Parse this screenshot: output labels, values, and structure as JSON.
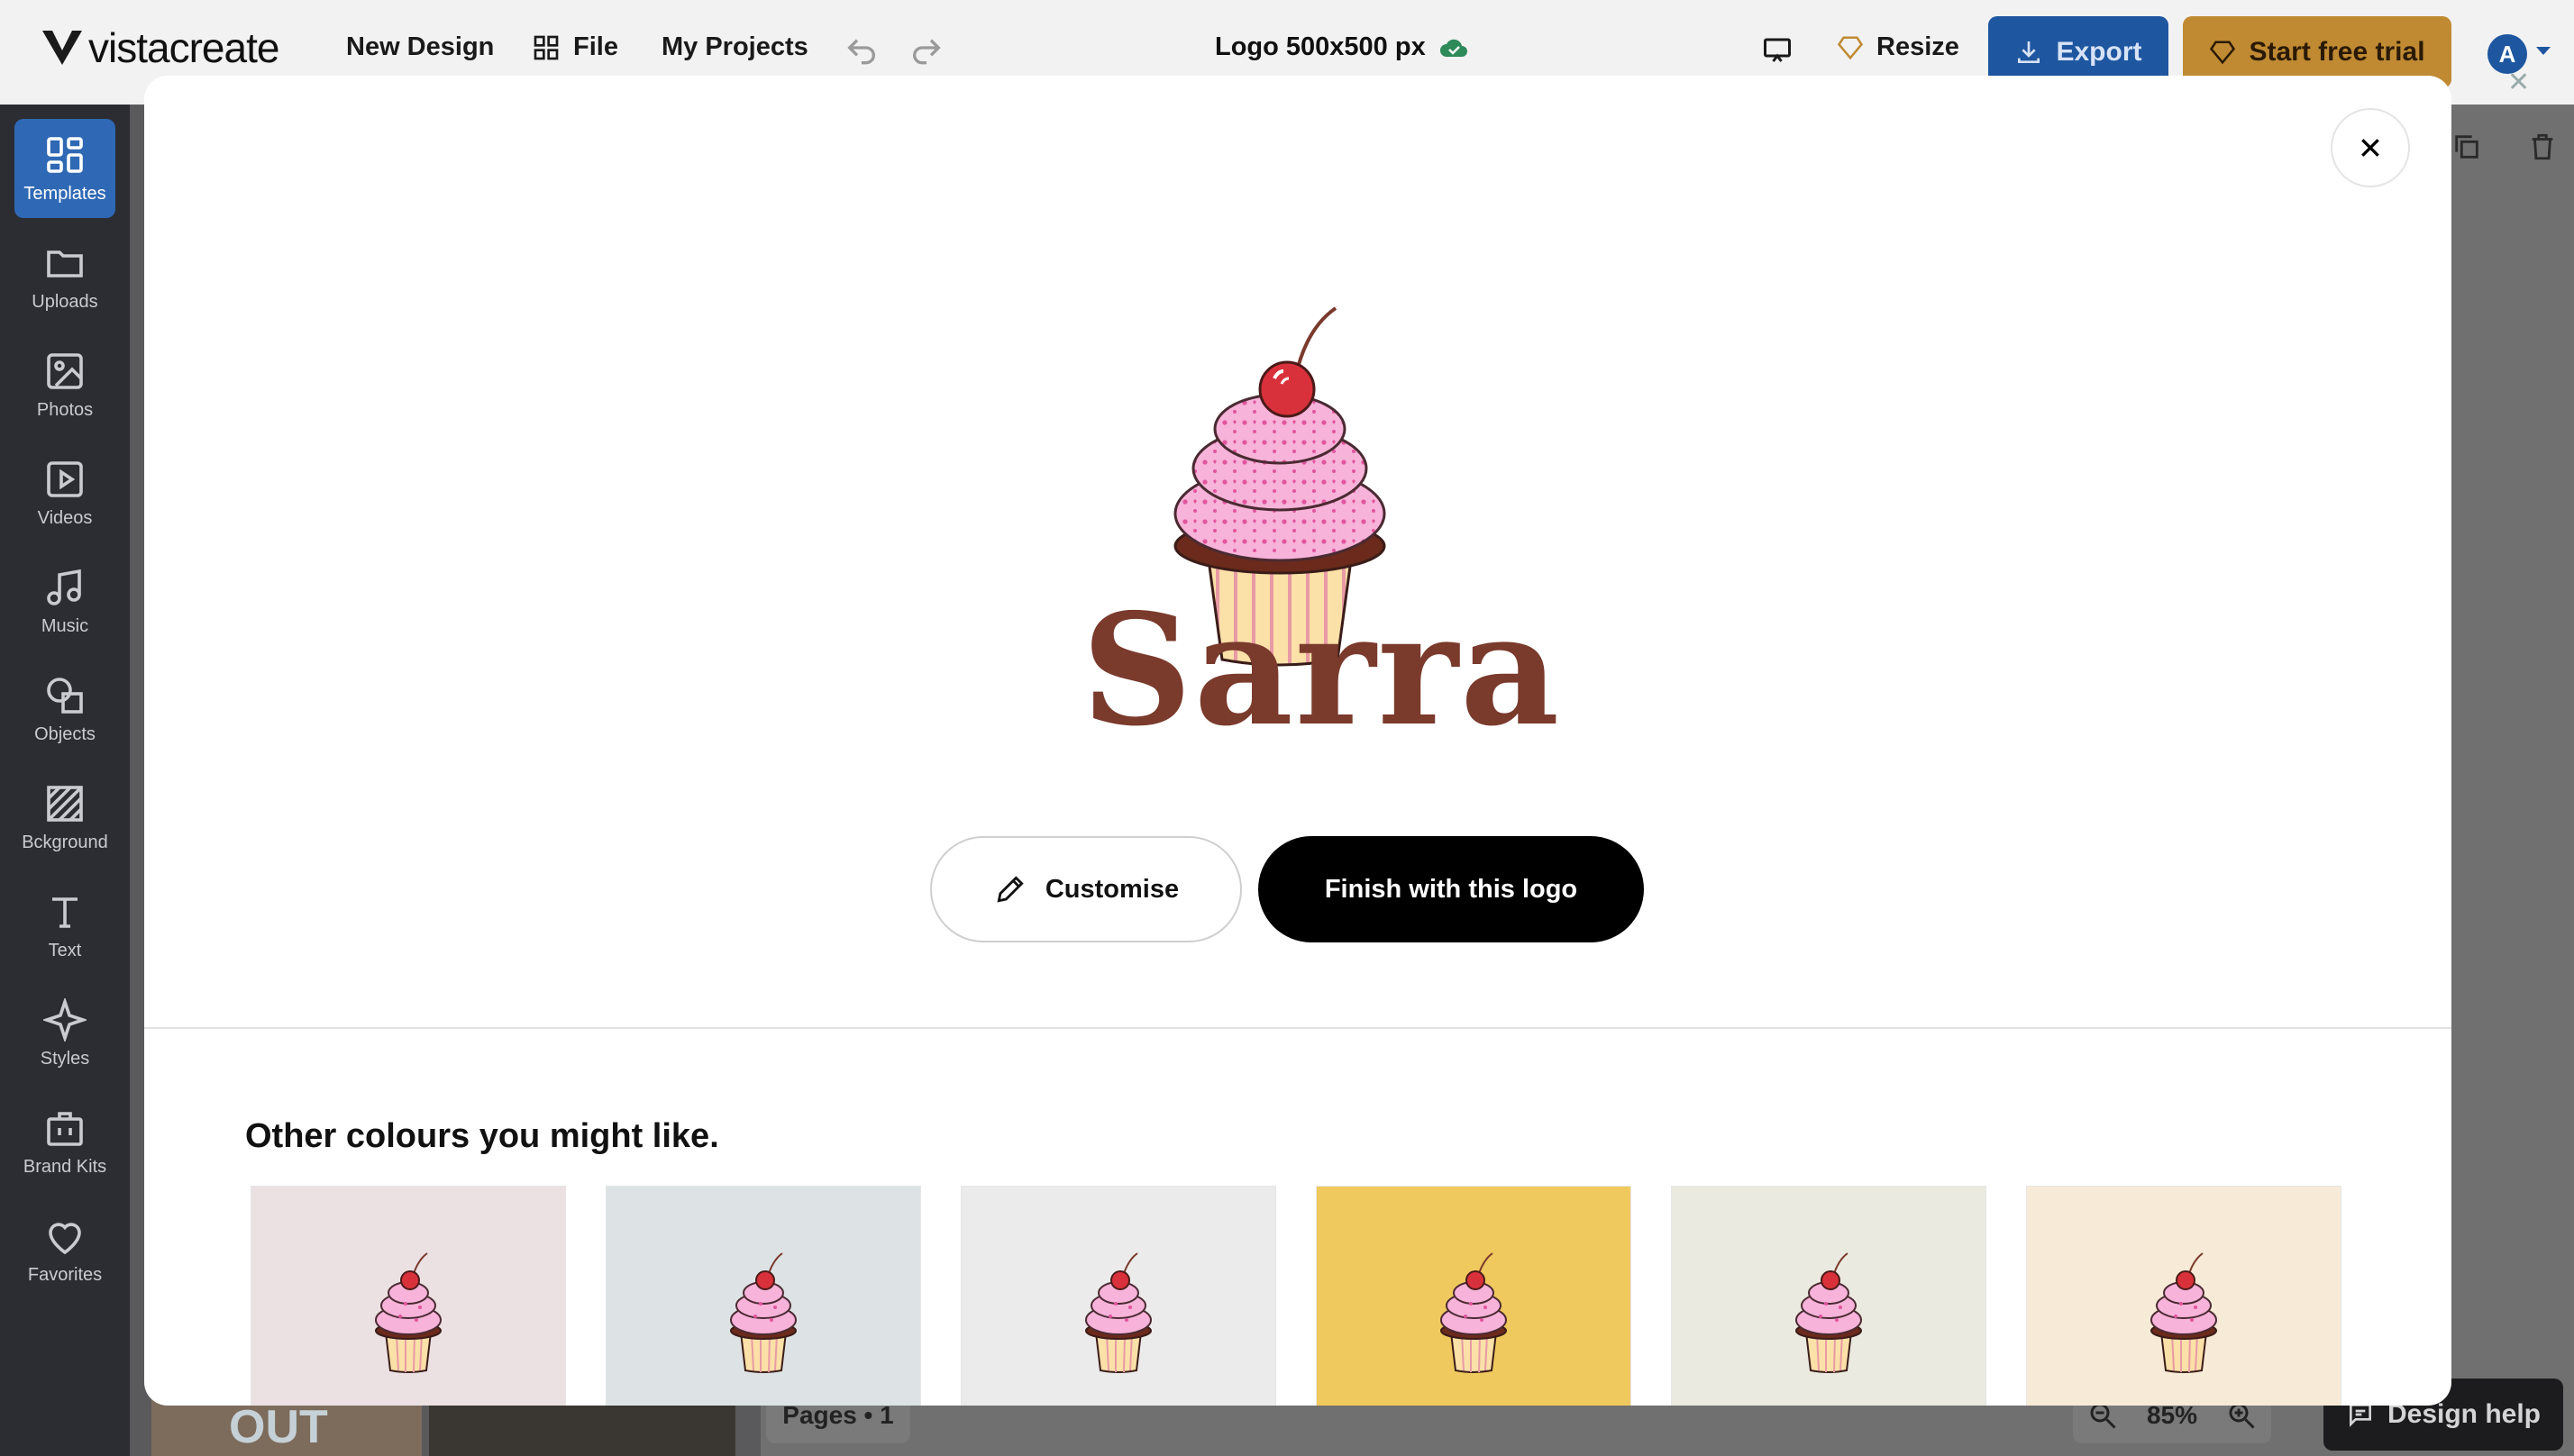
{
  "topbar": {
    "brand": "vistacreate",
    "new_design": "New Design",
    "file": "File",
    "my_projects": "My Projects",
    "doc_title": "Logo 500x500 px",
    "resize": "Resize",
    "export": "Export",
    "start_trial": "Start free trial",
    "avatar_initial": "A"
  },
  "sidebar": {
    "items": [
      {
        "label": "Templates"
      },
      {
        "label": "Uploads"
      },
      {
        "label": "Photos"
      },
      {
        "label": "Videos"
      },
      {
        "label": "Music"
      },
      {
        "label": "Objects"
      },
      {
        "label": "Bckground"
      },
      {
        "label": "Text"
      },
      {
        "label": "Styles"
      },
      {
        "label": "Brand Kits"
      },
      {
        "label": "Favorites"
      }
    ]
  },
  "background": {
    "thumb_text": "OUT",
    "pages": "Pages • 1",
    "zoom": "85%",
    "design_help": "Design help"
  },
  "modal": {
    "brand_name": "Sarra",
    "customise": "Customise",
    "finish": "Finish with this logo",
    "section_title": "Other colours you might like.",
    "variant_colors": [
      "#ebe1e3",
      "#dde3e4",
      "#ecebeb",
      "#f0c95e",
      "#ebeae0",
      "#f7ebd7"
    ]
  },
  "colors": {
    "accent_blue": "#1e56a0",
    "trial_gold": "#c08a33",
    "brand_brown": "#7a3a2c",
    "frosting_pink": "#f7b3d9",
    "cherry_red": "#d9313b"
  }
}
